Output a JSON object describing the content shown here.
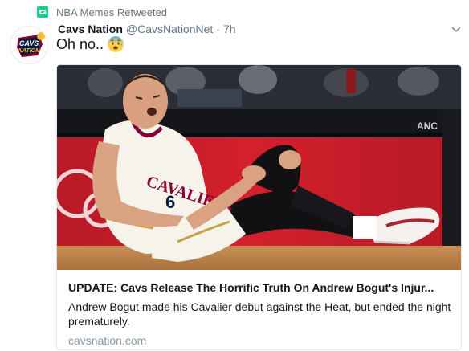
{
  "retweet": {
    "text": "NBA Memes Retweeted",
    "icon": "retweet-icon",
    "color": "#19cf86"
  },
  "tweet": {
    "author_name": "Cavs Nation",
    "author_handle": "@CavsNationNet",
    "separator": "·",
    "time": "7h",
    "text": "Oh no..",
    "emoji": "fearful-face-emoji",
    "avatar": {
      "logo_text_line1": "CAVS",
      "logo_text_line2": "NATION"
    }
  },
  "card": {
    "image": "basketball-player-injured-photo",
    "title": "UPDATE: Cavs Release The Horrific Truth On Andrew Bogut's Injur...",
    "description": "Andrew Bogut made his Cavalier debut against the Heat, but ended the night prematurely.",
    "domain": "cavsnation.com"
  },
  "colors": {
    "text_primary": "#14171a",
    "text_secondary": "#657786",
    "link_domain": "#8899a6",
    "border": "#e1e8ed"
  }
}
